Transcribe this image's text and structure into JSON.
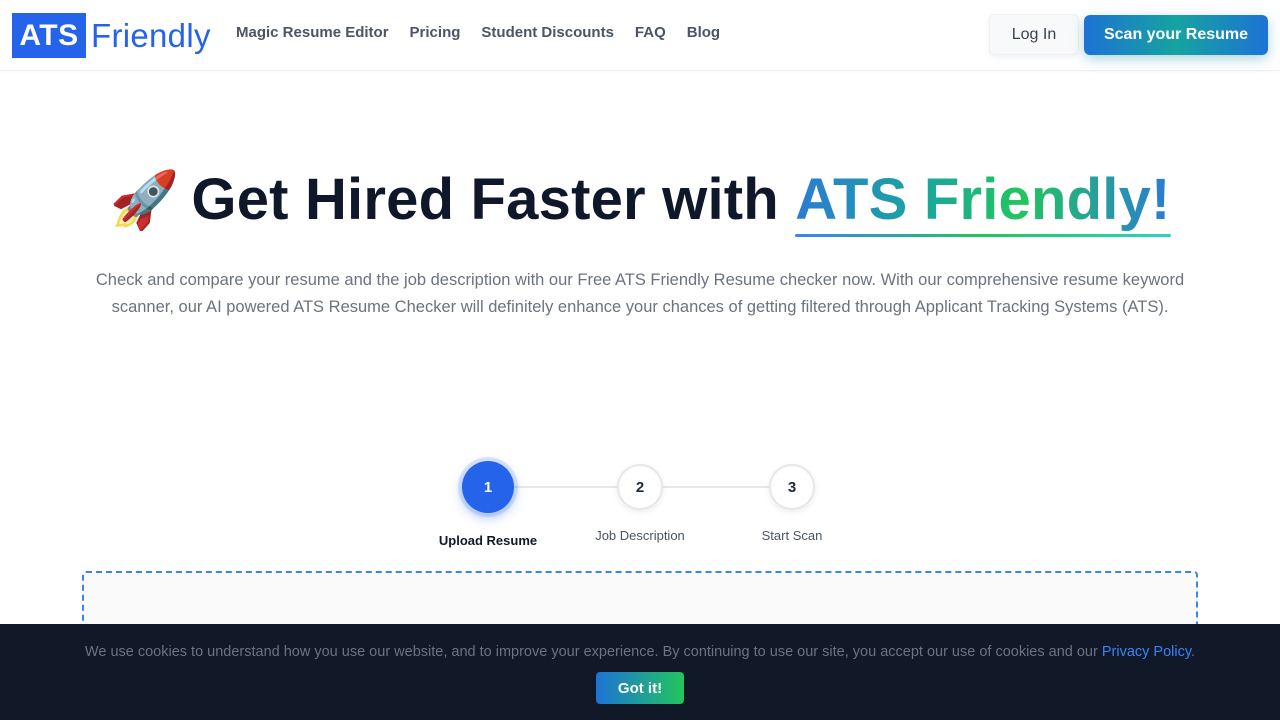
{
  "header": {
    "logo_box": "ATS",
    "logo_text": "Friendly",
    "nav": [
      "Magic Resume Editor",
      "Pricing",
      "Student Discounts",
      "FAQ",
      "Blog"
    ],
    "login_label": "Log In",
    "scan_label": "Scan your Resume"
  },
  "hero": {
    "rocket": "🚀",
    "title_plain": "Get Hired Faster with ",
    "title_brand": "ATS Friendly!",
    "description": "Check and compare your resume and the job description with our Free ATS Friendly Resume checker now. With our comprehensive resume keyword scanner, our AI powered ATS Resume Checker will definitely enhance your chances of getting filtered through Applicant Tracking Systems (ATS)."
  },
  "stepper": {
    "steps": [
      {
        "number": "1",
        "label": "Upload Resume",
        "active": true
      },
      {
        "number": "2",
        "label": "Job Description",
        "active": false
      },
      {
        "number": "3",
        "label": "Start Scan",
        "active": false
      }
    ]
  },
  "cookie": {
    "text": "We use cookies to understand how you use our website, and to improve your experience. By continuing to use our site, you accept our use of cookies and our ",
    "link_text": "Privacy Policy",
    "suffix": ".",
    "button_label": "Got it!"
  },
  "colors": {
    "brand_blue": "#2563eb",
    "gradient_green": "#22c55e",
    "cookie_bg": "#111827"
  }
}
